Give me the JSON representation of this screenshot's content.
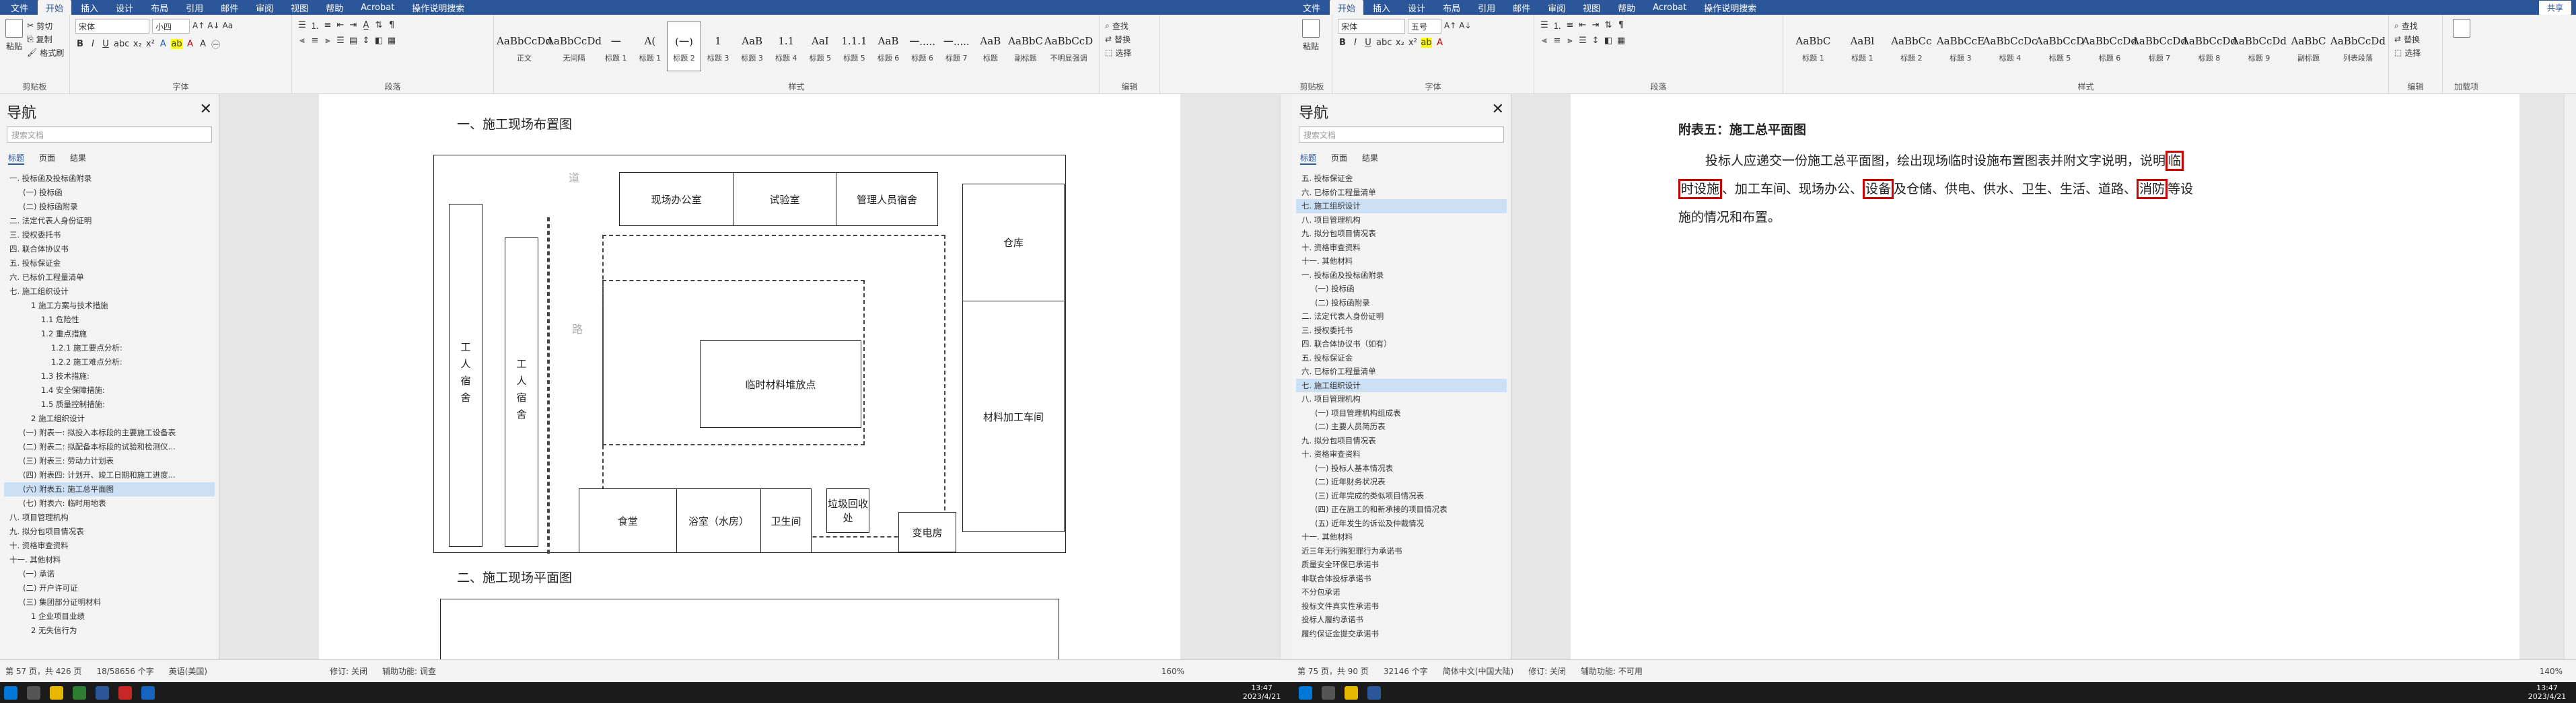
{
  "left": {
    "tabs": [
      "文件",
      "开始",
      "插入",
      "设计",
      "布局",
      "引用",
      "邮件",
      "审阅",
      "视图",
      "帮助",
      "Acrobat",
      "操作说明搜索"
    ],
    "active_tab": "开始",
    "clipboard": {
      "paste": "粘贴",
      "cut": "剪切",
      "copy": "复制",
      "format_painter": "格式刷",
      "label": "剪贴板"
    },
    "font": {
      "name": "宋体",
      "size": "小四",
      "label": "字体"
    },
    "paragraph": {
      "label": "段落"
    },
    "styles": {
      "label": "样式",
      "items": [
        {
          "sample": "AaBbCcDd",
          "name": "正文"
        },
        {
          "sample": "AaBbCcDd",
          "name": "无间隔"
        },
        {
          "sample": "一",
          "name": "标题 1"
        },
        {
          "sample": "A(",
          "name": "标题 1"
        },
        {
          "sample": "(一)",
          "name": "标题 2"
        },
        {
          "sample": "1",
          "name": "标题 3"
        },
        {
          "sample": "AaB",
          "name": "标题 3"
        },
        {
          "sample": "1.1",
          "name": "标题 4"
        },
        {
          "sample": "AaI",
          "name": "标题 5"
        },
        {
          "sample": "1.1.1",
          "name": "标题 5"
        },
        {
          "sample": "AaB",
          "name": "标题 6"
        },
        {
          "sample": "一.....",
          "name": "标题 6"
        },
        {
          "sample": "一.....",
          "name": "标题 7"
        },
        {
          "sample": "AaB",
          "name": "标题"
        },
        {
          "sample": "AaBbC",
          "name": "副标题"
        },
        {
          "sample": "AaBbCcD",
          "name": "不明显强调"
        }
      ]
    },
    "editing": {
      "find": "查找",
      "replace": "替换",
      "select": "选择",
      "label": "编辑"
    },
    "nav": {
      "title": "导航",
      "search_placeholder": "搜索文档",
      "tabs": [
        "标题",
        "页面",
        "结果"
      ]
    },
    "tree": [
      "一. 投标函及投标函附录",
      "(一) 投标函",
      "(二) 投标函附录",
      "二. 法定代表人身份证明",
      "三. 授权委托书",
      "四. 联合体协议书",
      "五. 投标保证金",
      "六. 已标价工程量清单",
      "七. 施工组织设计",
      "1 施工方案与技术措施",
      "1.1 危险性",
      "1.2 重点措施",
      "1.2.1 施工要点分析:",
      "1.2.2 施工难点分析:",
      "1.3 技术措施:",
      "1.4 安全保障措施:",
      "1.5 质量控制措施:",
      "2 施工组织设计",
      "(一) 附表一: 拟投入本标段的主要施工设备表",
      "(二) 附表二: 拟配备本标段的试验和检测仪...",
      "(三) 附表三: 劳动力计划表",
      "(四) 附表四: 计划开、竣工日期和施工进度...",
      "(六) 附表五: 施工总平面图",
      "(七) 附表六: 临时用地表",
      "八. 项目管理机构",
      "九. 拟分包项目情况表",
      "十. 资格审查资料",
      "十一. 其他材料",
      "(一) 承诺",
      "(二) 开户许可证",
      "(三) 集团部分证明材料",
      "1 企业项目业绩",
      "2 无失信行为"
    ],
    "selected_tree": "(六) 附表五: 施工总平面图",
    "doc": {
      "heading1": "一、施工现场布置图",
      "heading2": "二、施工现场平面图",
      "labels": {
        "office": "现场办公室",
        "lab": "试验室",
        "mgr_dorm": "管理人员宿舍",
        "warehouse": "仓库",
        "worker_dorm": "工人宿舍",
        "worker_dorm2": "工人宿舍",
        "stack": "临时材料堆放点",
        "processing": "材料加工车间",
        "canteen": "食堂",
        "bath": "浴室（水房）",
        "toilet": "卫生间",
        "garbage": "垃圾回收处",
        "substation": "变电房",
        "road1": "道",
        "road2": "路"
      }
    },
    "status": {
      "page": "第 57 页，共 426 页",
      "words": "18/58656 个字",
      "lang": "英语(美国)",
      "track": "修订: 关闭",
      "access": "辅助功能: 调查",
      "zoom": "160%"
    }
  },
  "right": {
    "tabs": [
      "文件",
      "开始",
      "插入",
      "设计",
      "布局",
      "引用",
      "邮件",
      "审阅",
      "视图",
      "帮助",
      "Acrobat",
      "操作说明搜索"
    ],
    "active_tab": "开始",
    "share": "共享",
    "clipboard": {
      "paste": "粘贴",
      "label": "剪贴板"
    },
    "font": {
      "name": "宋体",
      "size": "五号",
      "label": "字体"
    },
    "paragraph": {
      "label": "段落"
    },
    "styles": {
      "label": "样式",
      "items": [
        {
          "sample": "AaBbC",
          "name": "标题 1"
        },
        {
          "sample": "AaBl",
          "name": "标题 1"
        },
        {
          "sample": "AaBbCc",
          "name": "标题 2"
        },
        {
          "sample": "AaBbCcE",
          "name": "标题 3"
        },
        {
          "sample": "AaBbCcDc",
          "name": "标题 4"
        },
        {
          "sample": "AaBbCcD",
          "name": "标题 5"
        },
        {
          "sample": "AaBbCcDd",
          "name": "标题 6"
        },
        {
          "sample": "AaBbCcDd",
          "name": "标题 7"
        },
        {
          "sample": "AaBbCcDd",
          "name": "标题 8"
        },
        {
          "sample": "AaBbCcDd",
          "name": "标题 9"
        },
        {
          "sample": "AaBbC",
          "name": "副标题"
        },
        {
          "sample": "AaBbCcDd",
          "name": "列表段落"
        }
      ]
    },
    "editing": {
      "find": "查找",
      "replace": "替换",
      "select": "选择",
      "label": "编辑"
    },
    "addins": {
      "label": "加载项"
    },
    "nav": {
      "title": "导航",
      "search_placeholder": "搜索文档",
      "tabs": [
        "标题",
        "页面",
        "结果"
      ]
    },
    "tree": [
      "五. 投标保证金",
      "六. 已标价工程量清单",
      "七. 施工组织设计",
      "八. 项目管理机构",
      "九. 拟分包项目情况表",
      "十. 资格审查资料",
      "十一. 其他材料",
      "一. 投标函及投标函附录",
      "(一) 投标函",
      "(二) 投标函附录",
      "二. 法定代表人身份证明",
      "三. 授权委托书",
      "四. 联合体协议书（如有）",
      "五. 投标保证金",
      "六. 已标价工程量清单",
      "七. 施工组织设计",
      "八. 项目管理机构",
      "(一) 项目管理机构组成表",
      "(二) 主要人员简历表",
      "九. 拟分包项目情况表",
      "十. 资格审查资料",
      "(一) 投标人基本情况表",
      "(二) 近年财务状况表",
      "(三) 近年完成的类似项目情况表",
      "(四) 正在施工的和新承接的项目情况表",
      "(五) 近年发生的诉讼及仲裁情况",
      "十一. 其他材料",
      "近三年无行贿犯罪行为承诺书",
      "质量安全环保已承诺书",
      "非联合体投标承诺书",
      "不分包承诺",
      "投标文件真实性承诺书",
      "投标人履约承诺书",
      "履约保证金提交承诺书"
    ],
    "selected_tree": "七. 施工组织设计",
    "doc": {
      "title": "附表五：施工总平面图",
      "para_a": "投标人应递交一份施工总平面图，绘出现场临时设施布置图表并附文字说明，说明",
      "hl1": "临",
      "hl1b": "时设施",
      "para_b": "、加工车间、现场办公、",
      "hl2": "设备",
      "para_c": "及仓储、供电、供水、卫生、生活、道路、",
      "hl3": "消防",
      "para_d": "等设",
      "para_e": "施的情况和布置。"
    },
    "status": {
      "page": "第 75 页，共 90 页",
      "words": "32146 个字",
      "lang": "简体中文(中国大陆)",
      "track": "修订: 关闭",
      "access": "辅助功能: 不可用",
      "zoom": "140%"
    }
  },
  "taskbar": {
    "time": "13:47",
    "date": "2023/4/21"
  },
  "colors": {
    "brand": "#2b579a",
    "highlight": "#cc0000"
  }
}
